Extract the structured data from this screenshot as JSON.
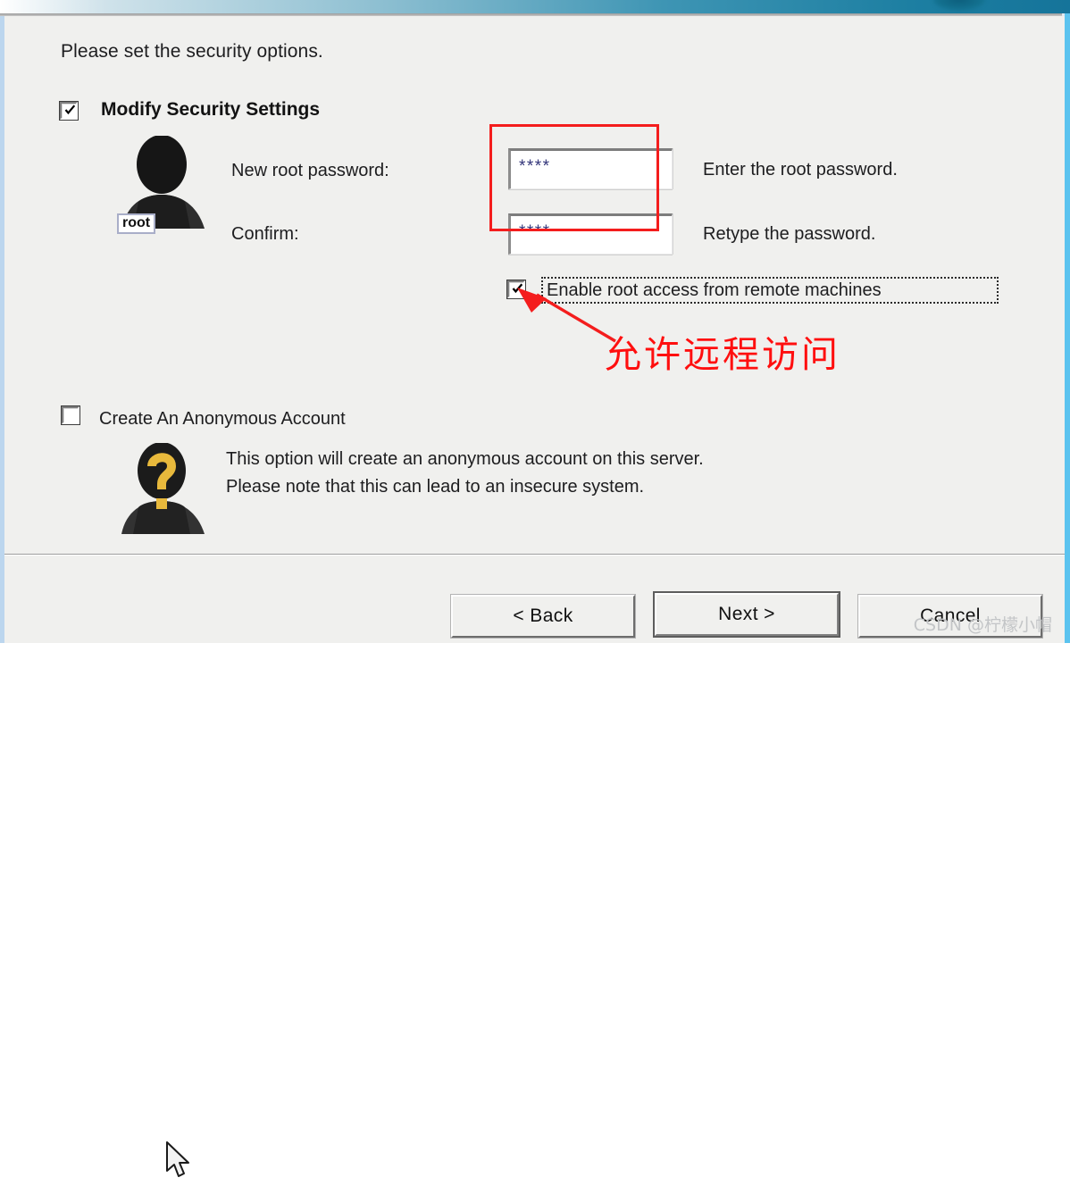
{
  "window": {
    "titlebar_present": true,
    "accent_color": "#1d7fa2",
    "dialog_bg": "#f0f0ee"
  },
  "header": {
    "instruction": "Please set the security options."
  },
  "security_section": {
    "checkbox_label": "Modify Security Settings",
    "checked": true,
    "avatar_badge": "root",
    "fields": [
      {
        "label": "New root password:",
        "value": "****",
        "hint": "Enter the root password.",
        "name": "new-root-password"
      },
      {
        "label": "Confirm:",
        "value": "****",
        "hint": "Retype the password.",
        "name": "confirm-password"
      }
    ],
    "remote_access": {
      "label": "Enable root access from remote machines",
      "checked": true,
      "focused": true
    }
  },
  "anonymous_section": {
    "checkbox_label": "Create An Anonymous Account",
    "checked": false,
    "description_line1": "This option will create an anonymous account on this server.",
    "description_line2": "Please note that this can lead to an insecure system."
  },
  "annotations": {
    "highlight_color": "#f41d1d",
    "chinese_note": "允许远程访问"
  },
  "footer": {
    "buttons": [
      {
        "label": "< Back",
        "name": "back-button",
        "default": false
      },
      {
        "label": "Next >",
        "name": "next-button",
        "default": true
      },
      {
        "label": "Cancel",
        "name": "cancel-button",
        "default": false
      }
    ]
  },
  "watermark": {
    "text": "CSDN @柠檬小帽"
  }
}
